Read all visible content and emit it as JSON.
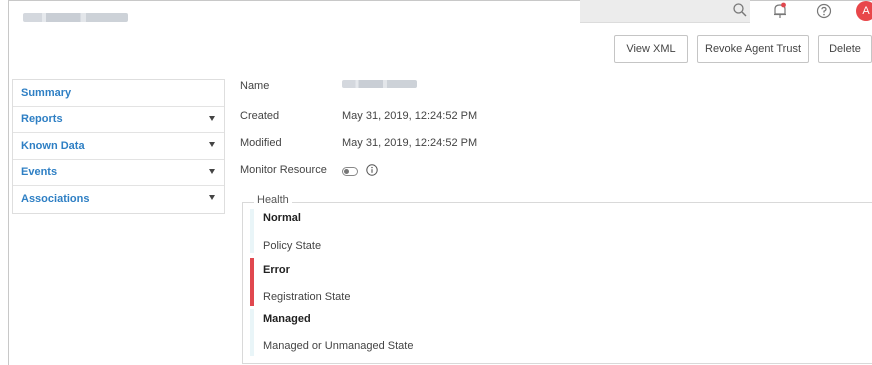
{
  "header": {
    "actions": {
      "view_xml": "View XML",
      "revoke_trust": "Revoke Agent Trust",
      "delete": "Delete"
    },
    "avatar_initial": "A",
    "icons": [
      "search-icon",
      "bell-icon",
      "help-icon"
    ],
    "accent_color": "#e8474a"
  },
  "sidebar": {
    "items": [
      {
        "label": "Summary",
        "expandable": false
      },
      {
        "label": "Reports",
        "expandable": true
      },
      {
        "label": "Known Data",
        "expandable": true
      },
      {
        "label": "Events",
        "expandable": true
      },
      {
        "label": "Associations",
        "expandable": true
      }
    ],
    "link_color": "#2e7fc4"
  },
  "details": {
    "name_label": "Name",
    "created_label": "Created",
    "created_value": "May 31, 2019, 12:24:52 PM",
    "modified_label": "Modified",
    "modified_value": "May 31, 2019, 12:24:52 PM",
    "monitor_label": "Monitor Resource",
    "monitor_enabled": false
  },
  "health": {
    "legend": "Health",
    "entries": [
      {
        "state": "Normal",
        "description": "Policy State",
        "indicator_color": "#e9f5f8"
      },
      {
        "state": "Error",
        "description": "Registration State",
        "indicator_color": "#e0484f"
      },
      {
        "state": "Managed",
        "description": "Managed or Unmanaged State",
        "indicator_color": "#e9f5f8"
      }
    ]
  }
}
